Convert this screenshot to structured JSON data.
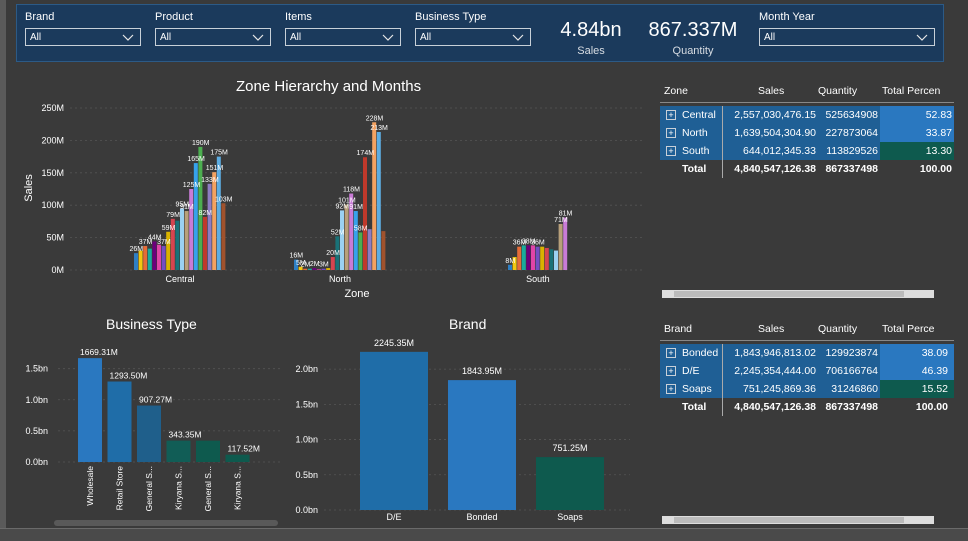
{
  "filters": [
    {
      "label": "Brand",
      "value": "All"
    },
    {
      "label": "Product",
      "value": "All"
    },
    {
      "label": "Items",
      "value": "All"
    },
    {
      "label": "Business Type",
      "value": "All"
    },
    {
      "label": "Month Year",
      "value": "All"
    }
  ],
  "kpis": [
    {
      "value": "4.84bn",
      "caption": "Sales"
    },
    {
      "value": "867.337M",
      "caption": "Quantity"
    }
  ],
  "zone_chart": {
    "title": "Zone Hierarchy and Months",
    "xlabel": "Zone",
    "ylabel": "Sales",
    "yticks": [
      "250M",
      "200M",
      "150M",
      "100M",
      "50M",
      "0M"
    ]
  },
  "business_chart": {
    "title": "Business Type",
    "yticks": [
      "1.5bn",
      "1.0bn",
      "0.5bn",
      "0.0bn"
    ]
  },
  "brand_chart": {
    "title": "Brand",
    "yticks": [
      "2.0bn",
      "1.5bn",
      "1.0bn",
      "0.5bn",
      "0.0bn"
    ]
  },
  "zone_table": {
    "headers": [
      "Zone",
      "Sales",
      "Quantity",
      "Total Percen"
    ],
    "rows": [
      {
        "name": "Central",
        "sales": "2,557,030,476.15",
        "qty": "525634908",
        "pct": "52.83",
        "color": "#2a78c0"
      },
      {
        "name": "North",
        "sales": "1,639,504,304.90",
        "qty": "227873064",
        "pct": "33.87",
        "color": "#2a78c0"
      },
      {
        "name": "South",
        "sales": "644,012,345.33",
        "qty": "113829526",
        "pct": "13.30",
        "color": "#0e5a4e"
      }
    ],
    "total": {
      "name": "Total",
      "sales": "4,840,547,126.38",
      "qty": "867337498",
      "pct": "100.00"
    }
  },
  "brand_table": {
    "headers": [
      "Brand",
      "Sales",
      "Quantity",
      "Total Perce"
    ],
    "rows": [
      {
        "name": "Bonded",
        "sales": "1,843,946,813.02",
        "qty": "129923874",
        "pct": "38.09",
        "color": "#2a78c0"
      },
      {
        "name": "D/E",
        "sales": "2,245,354,444.00",
        "qty": "706166764",
        "pct": "46.39",
        "color": "#2a78c0"
      },
      {
        "name": "Soaps",
        "sales": "751,245,869.36",
        "qty": "31246860",
        "pct": "15.52",
        "color": "#0e5a4e"
      }
    ],
    "total": {
      "name": "Total",
      "sales": "4,840,547,126.38",
      "qty": "867337498",
      "pct": "100.00"
    }
  },
  "chart_data": [
    {
      "type": "bar",
      "title": "Zone Hierarchy and Months",
      "xlabel": "Zone",
      "ylabel": "Sales",
      "ylim": [
        0,
        250000000
      ],
      "grid": true,
      "groups": [
        {
          "name": "Central",
          "values": [
            26,
            30,
            37,
            33,
            44,
            39,
            37,
            59,
            79,
            76,
            95,
            91,
            125,
            165,
            190,
            82,
            133,
            151,
            175,
            103
          ],
          "labels": [
            "26M",
            "",
            "37M",
            "",
            "44M",
            "",
            "37M",
            "59M",
            "79M",
            "",
            "95M",
            "91M",
            "125M",
            "165M",
            "190M",
            "82M",
            "133M",
            "151M",
            "175M",
            "103M"
          ]
        },
        {
          "name": "North",
          "values": [
            16,
            5,
            2,
            2,
            3,
            1,
            2,
            3,
            20,
            52,
            92,
            101,
            118,
            91,
            58,
            174,
            63,
            228,
            213,
            60
          ],
          "labels": [
            "16M",
            "5M",
            "2M",
            "",
            "2M",
            "",
            "3M",
            "",
            "20M",
            "52M",
            "92M",
            "101M",
            "118M",
            "91M",
            "58M",
            "174M",
            "",
            "228M",
            "213M",
            ""
          ]
        },
        {
          "name": "South",
          "values": [
            8,
            20,
            36,
            38,
            38,
            38,
            36,
            36,
            34,
            32,
            30,
            71,
            81
          ],
          "labels": [
            "8M",
            "",
            "36M",
            "",
            "38M",
            "",
            "36M",
            "",
            "",
            "",
            "",
            "71M",
            "81M"
          ]
        }
      ]
    },
    {
      "type": "bar",
      "title": "Business Type",
      "categories": [
        "Wholesale",
        "Retail Store",
        "General S...",
        "Kiryana S...",
        "General S...",
        "Kiryana S..."
      ],
      "values": [
        1669.31,
        1293.5,
        907.27,
        343.35,
        343.35,
        117.52
      ],
      "labels": [
        "1669.31M",
        "1293.50M",
        "907.27M",
        "343.35M",
        "",
        "117.52M"
      ],
      "unit": "M",
      "ylim": [
        0,
        1800
      ],
      "grid": true
    },
    {
      "type": "bar",
      "title": "Brand",
      "categories": [
        "D/E",
        "Bonded",
        "Soaps"
      ],
      "values": [
        2245.35,
        1843.95,
        751.25
      ],
      "labels": [
        "2245.35M",
        "1843.95M",
        "751.25M"
      ],
      "unit": "M",
      "ylim": [
        0,
        2300
      ],
      "grid": true
    }
  ],
  "colors": {
    "palette": [
      "#2e7fc4",
      "#f2c811",
      "#e66c37",
      "#1aab9b",
      "#6b007b",
      "#e044a7",
      "#744ec2",
      "#d9b300",
      "#d64550",
      "#197278",
      "#9bd1f2",
      "#b8a07a",
      "#c97bd6",
      "#36a2eb",
      "#4caf50",
      "#c0392b",
      "#8e7cc3",
      "#f4a261",
      "#5dade2",
      "#a0522d"
    ],
    "business_bars": [
      "#2a78c0",
      "#1f6da8",
      "#1f5f8b",
      "#115d56",
      "#0e5a4e",
      "#0e5a4e"
    ],
    "brand_bars": [
      "#1f6da8",
      "#2a78c0",
      "#0e5a4e"
    ]
  }
}
